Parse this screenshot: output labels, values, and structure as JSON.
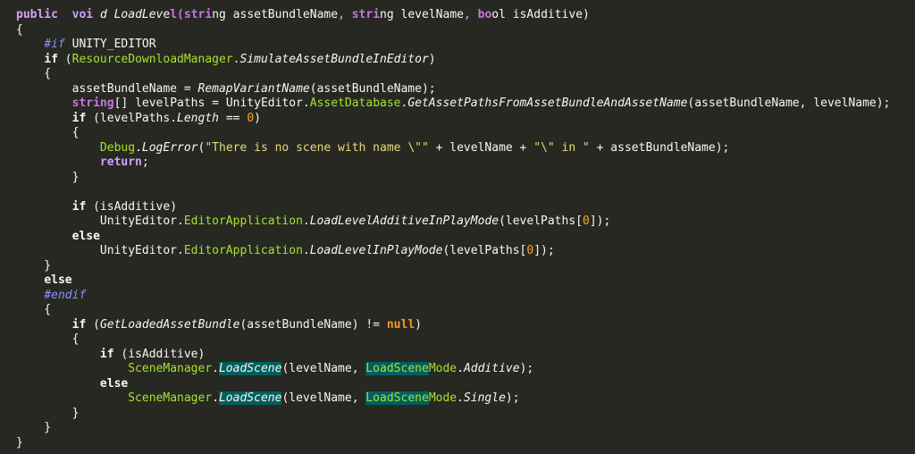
{
  "lines": [
    "public void LoadLevel(string assetBundleName, string levelName, bool isAdditive)",
    "{",
    "    #if UNITY_EDITOR",
    "    if (ResourceDownloadManager.SimulateAssetBundleInEditor)",
    "    {",
    "        assetBundleName = RemapVariantName(assetBundleName);",
    "        string[] levelPaths = UnityEditor.AssetDatabase.GetAssetPathsFromAssetBundleAndAssetName(assetBundleName, levelName);",
    "        if (levelPaths.Length == 0)",
    "        {",
    "            Debug.LogError(\"There is no scene with name \\\"\" + levelName + \"\\\" in \" + assetBundleName);",
    "            return;",
    "        }",
    "",
    "        if (isAdditive)",
    "            UnityEditor.EditorApplication.LoadLevelAdditiveInPlayMode(levelPaths[0]);",
    "        else",
    "            UnityEditor.EditorApplication.LoadLevelInPlayMode(levelPaths[0]);",
    "    }",
    "    else",
    "    #endif",
    "    {",
    "        if (GetLoadedAssetBundle(assetBundleName) != null)",
    "        {",
    "            if (isAdditive)",
    "                SceneManager.LoadScene(levelName, LoadSceneMode.Additive);",
    "            else",
    "                SceneManager.LoadScene(levelName, LoadSceneMode.Single);",
    "        }",
    "    }",
    "}"
  ],
  "colors": {
    "background": "#272822",
    "foreground": "#f8f8f2",
    "type_keyword": "#c678dd",
    "class_name": "#a6e22e",
    "string": "#e6db74",
    "number": "#f5a623",
    "null_keyword": "#fd971f",
    "preprocessor": "#8e8eff",
    "search_highlight": "#005f5f"
  }
}
